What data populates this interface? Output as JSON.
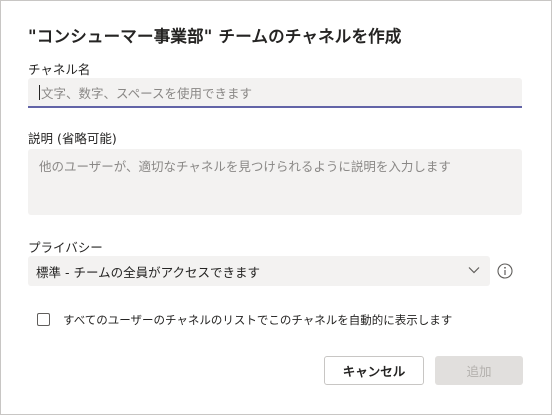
{
  "dialog": {
    "title": "\"コンシューマー事業部\" チームのチャネルを作成",
    "channel_name": {
      "label": "チャネル名",
      "placeholder": "文字、数字、スペースを使用できます"
    },
    "description": {
      "label": "説明 (省略可能)",
      "placeholder": "他のユーザーが、適切なチャネルを見つけられるように説明を入力します"
    },
    "privacy": {
      "label": "プライバシー",
      "selected": "標準 - チームの全員がアクセスできます"
    },
    "auto_show": {
      "label": "すべてのユーザーのチャネルのリストでこのチャネルを自動的に表示します",
      "checked": false
    },
    "buttons": {
      "cancel": "キャンセル",
      "add": "追加"
    }
  },
  "colors": {
    "accent": "#6264a7",
    "field_bg": "#f3f2f1",
    "disabled_bg": "#e1dfdd"
  },
  "icons": [
    "chevron-down-icon",
    "info-icon"
  ]
}
